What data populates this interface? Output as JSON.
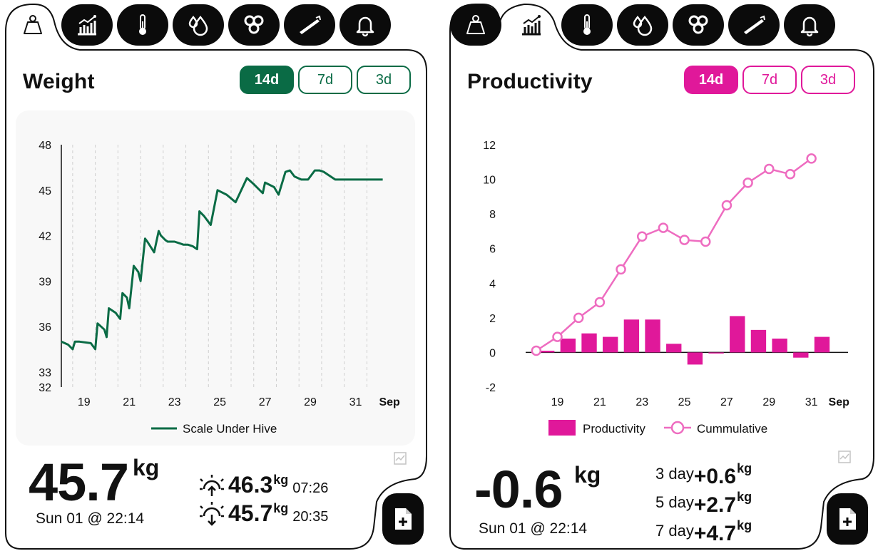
{
  "weight_panel": {
    "title": "Weight",
    "accent": "#0a6b45",
    "ranges": [
      "14d",
      "7d",
      "3d"
    ],
    "selected_range": "14d",
    "tabs": [
      "scale-icon",
      "chart-icon",
      "thermometer-icon",
      "drops-icon",
      "honeycomb-icon",
      "hive-tool-icon",
      "bell-icon"
    ],
    "active_tab": 0,
    "big_value": "45.7",
    "big_unit": "kg",
    "timestamp": "Sun 01 @ 22:14",
    "sunrise": {
      "value": "46.3",
      "unit": "kg",
      "time": "07:26"
    },
    "sunset": {
      "value": "45.7",
      "unit": "kg",
      "time": "20:35"
    }
  },
  "productivity_panel": {
    "title": "Productivity",
    "accent": "#e0189a",
    "ranges": [
      "14d",
      "7d",
      "3d"
    ],
    "selected_range": "14d",
    "tabs": [
      "scale-icon",
      "chart-icon",
      "thermometer-icon",
      "drops-icon",
      "honeycomb-icon",
      "hive-tool-icon",
      "bell-icon"
    ],
    "active_tab": 1,
    "big_value": "-0.6",
    "big_unit": "kg",
    "timestamp": "Sun 01 @ 22:14",
    "summaries": [
      {
        "label": "3 day",
        "value": "+0.6",
        "unit": "kg"
      },
      {
        "label": "5 day",
        "value": "+2.7",
        "unit": "kg"
      },
      {
        "label": "7 day",
        "value": "+4.7",
        "unit": "kg"
      }
    ]
  },
  "chart_data": [
    {
      "type": "line",
      "title": "Weight",
      "yticks": [
        "32",
        "33",
        "36",
        "39",
        "42",
        "45",
        "48"
      ],
      "xticks": [
        "19",
        "21",
        "23",
        "25",
        "27",
        "29",
        "31",
        "Sep"
      ],
      "ylim": [
        32,
        48
      ],
      "xlim": [
        18,
        33
      ],
      "grid": "vertical dashed",
      "legend_position": "bottom",
      "series": [
        {
          "name": "Scale Under Hive",
          "color": "#0a6b45",
          "x": [
            18.0,
            18.3,
            18.5,
            18.6,
            18.8,
            19.3,
            19.5,
            19.6,
            19.9,
            20.0,
            20.1,
            20.4,
            20.6,
            20.7,
            20.9,
            21.0,
            21.2,
            21.4,
            21.5,
            21.7,
            21.8,
            22.1,
            22.3,
            22.4,
            22.6,
            22.7,
            23.0,
            23.2,
            23.4,
            23.6,
            23.8,
            24.0,
            24.1,
            24.3,
            24.6,
            24.9,
            25.3,
            25.7,
            26.2,
            26.5,
            26.9,
            27.0,
            27.4,
            27.6,
            27.9,
            28.1,
            28.3,
            28.6,
            28.9,
            29.2,
            29.4,
            29.6,
            29.9,
            30.1,
            30.3,
            30.5,
            30.9,
            31.0,
            31.2,
            31.5,
            31.6,
            31.9,
            32.2
          ],
          "y": [
            35.0,
            34.8,
            34.5,
            35.0,
            35.0,
            34.9,
            34.5,
            36.2,
            35.8,
            35.3,
            37.2,
            36.9,
            36.5,
            38.2,
            37.9,
            37.2,
            40.0,
            39.6,
            39.0,
            41.8,
            41.6,
            40.9,
            42.3,
            42.0,
            41.7,
            41.6,
            41.6,
            41.5,
            41.4,
            41.4,
            41.3,
            41.1,
            43.6,
            43.3,
            42.7,
            45.0,
            44.7,
            44.2,
            45.8,
            45.4,
            44.8,
            45.5,
            45.2,
            44.7,
            46.2,
            46.3,
            45.9,
            45.7,
            45.7,
            46.3,
            46.3,
            46.2,
            45.9,
            45.7,
            45.7,
            45.7,
            45.7,
            45.7,
            45.7,
            45.7,
            45.7,
            45.7,
            45.7
          ]
        }
      ]
    },
    {
      "type": "bar",
      "title": "Productivity",
      "xticks": [
        "19",
        "21",
        "23",
        "25",
        "27",
        "29",
        "31",
        "Sep"
      ],
      "yticks": [
        "-2",
        "0",
        "2",
        "4",
        "6",
        "8",
        "10",
        "12"
      ],
      "ylim": [
        -2,
        12
      ],
      "legend_position": "bottom",
      "categories": [
        "18",
        "19",
        "20",
        "21",
        "22",
        "23",
        "24",
        "25",
        "26",
        "27",
        "28",
        "29",
        "30",
        "31"
      ],
      "series": [
        {
          "name": "Productivity",
          "type": "bar",
          "color": "#e0189a",
          "values": [
            0.1,
            0.8,
            1.1,
            0.9,
            1.9,
            1.9,
            0.5,
            -0.7,
            -0.05,
            2.1,
            1.3,
            0.8,
            -0.3,
            0.9
          ]
        },
        {
          "name": "Cummulative",
          "type": "line",
          "color": "#ee6cc0",
          "values": [
            0.1,
            0.9,
            2.0,
            2.9,
            4.8,
            6.7,
            7.2,
            6.5,
            6.4,
            8.5,
            9.8,
            10.6,
            10.3,
            11.2
          ]
        }
      ]
    }
  ]
}
